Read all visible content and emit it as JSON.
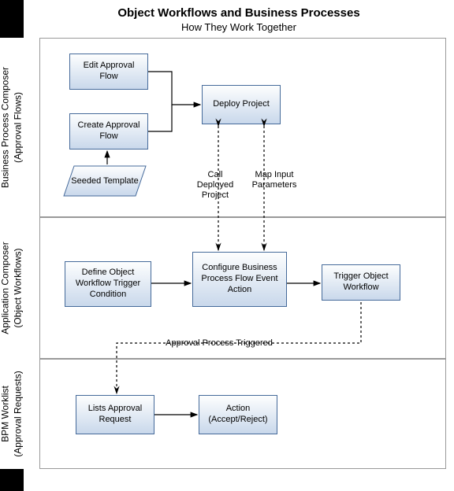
{
  "title": "Object Workflows and Business Processes",
  "subtitle": "How They Work Together",
  "swimlanes": {
    "s1": {
      "name": "Business Process Composer",
      "sub": "(Approval Flows)"
    },
    "s2": {
      "name": "Application Composer",
      "sub": "(Object Workflows)"
    },
    "s3": {
      "name": "BPM Worklist",
      "sub": "(Approval Requests)"
    }
  },
  "boxes": {
    "edit_approval": "Edit Approval Flow",
    "create_approval": "Create Approval Flow",
    "seeded_template": "Seeded Template",
    "deploy_project": "Deploy Project",
    "define_trigger": "Define Object Workflow Trigger Condition",
    "configure_bpf": "Configure Business Process Flow Event Action",
    "trigger_workflow": "Trigger Object Workflow",
    "lists_approval": "Lists Approval Request",
    "action_accept": "Action (Accept/Reject)"
  },
  "labels": {
    "call_deployed": "Call Deployed Project",
    "map_input": "Map Input Parameters",
    "approval_triggered": "Approval Process Triggered"
  }
}
